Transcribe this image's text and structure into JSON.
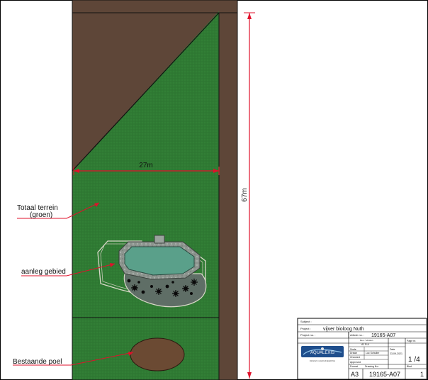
{
  "drawing": {
    "dimension_width": "27m",
    "dimension_length": "67m",
    "label_terrain_line1": "Totaal terrein",
    "label_terrain_line2": "(groen)",
    "label_construction": "aanleg gebied",
    "label_pond": "Bestaande poel"
  },
  "title_block": {
    "subject_label": "Subject :",
    "project_label": "Project :",
    "project_value": "vijver bioloog Nuth",
    "project_no_label": "Project no. :",
    "article_no_label": "Article no. :",
    "article_no_value": "19165-A07",
    "rev_label": "Rev. / Version",
    "rev_value": "A1 B A",
    "scale_label": "Scale",
    "date_label": "Date",
    "page_label": "Page nr.",
    "drawn_label": "Drawn",
    "drawn_value": "Luc Schuller",
    "date_value": "23-09-2021",
    "page_value": "1 /4",
    "checked_label": "Checked",
    "approved_label": "Approved",
    "format_label": "Format",
    "format_value": "A3",
    "drawing_no_label": "Drawing No.:",
    "drawing_no_value": "19165-A07",
    "sheet_label": "Blad",
    "sheet_value": "1",
    "logo_text": "AQUALEXIS",
    "logo_tagline": "DESIGN & ENGINEERING"
  },
  "colors": {
    "brown": "#5e4638",
    "grass": "#2f7a33",
    "water": "#5aa08a",
    "dimension_red": "#e0112b",
    "plinth": "#9aa39d"
  }
}
